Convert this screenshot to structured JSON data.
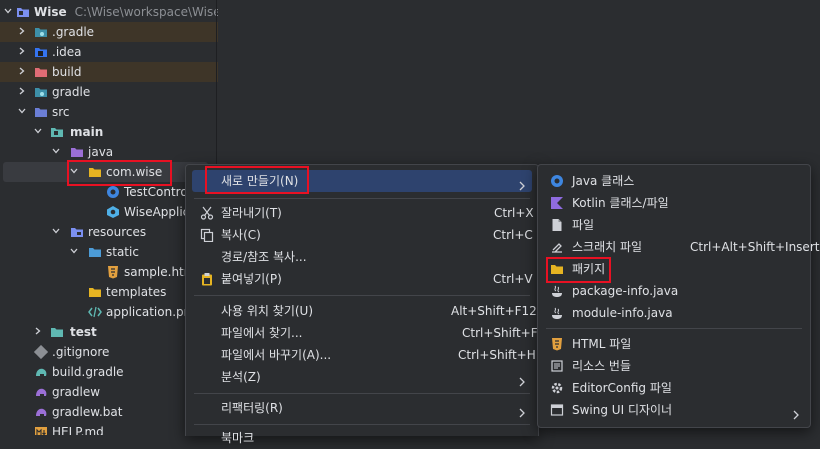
{
  "tree": {
    "root": {
      "name": "Wise",
      "path": "C:\\Wise\\workspace\\Wise"
    },
    "items": [
      {
        "label": ".gradle"
      },
      {
        "label": ".idea"
      },
      {
        "label": "build"
      },
      {
        "label": "gradle"
      },
      {
        "label": "src"
      },
      {
        "label": "main"
      },
      {
        "label": "java"
      },
      {
        "label": "com.wise"
      },
      {
        "label": "TestControl"
      },
      {
        "label": "WiseApplica"
      },
      {
        "label": "resources"
      },
      {
        "label": "static"
      },
      {
        "label": "sample.htm"
      },
      {
        "label": "templates"
      },
      {
        "label": "application.pro"
      },
      {
        "label": "test"
      },
      {
        "label": ".gitignore"
      },
      {
        "label": "build.gradle"
      },
      {
        "label": "gradlew"
      },
      {
        "label": "gradlew.bat"
      },
      {
        "label": "HELP.md"
      }
    ]
  },
  "context_menu": {
    "items": [
      {
        "label": "새로 만들기(N)",
        "shortcut": ""
      },
      {
        "label": "잘라내기(T)",
        "shortcut": "Ctrl+X"
      },
      {
        "label": "복사(C)",
        "shortcut": "Ctrl+C"
      },
      {
        "label": "경로/참조 복사...",
        "shortcut": ""
      },
      {
        "label": "붙여넣기(P)",
        "shortcut": "Ctrl+V"
      },
      {
        "label": "사용 위치 찾기(U)",
        "shortcut": "Alt+Shift+F12"
      },
      {
        "label": "파일에서 찾기...",
        "shortcut": "Ctrl+Shift+F"
      },
      {
        "label": "파일에서 바꾸기(A)...",
        "shortcut": "Ctrl+Shift+H"
      },
      {
        "label": "분석(Z)",
        "shortcut": ""
      },
      {
        "label": "리팩터링(R)",
        "shortcut": ""
      },
      {
        "label": "북마크",
        "shortcut": ""
      }
    ]
  },
  "new_submenu": {
    "items": [
      {
        "label": "Java 클래스",
        "shortcut": ""
      },
      {
        "label": "Kotlin 클래스/파일",
        "shortcut": ""
      },
      {
        "label": "파일",
        "shortcut": ""
      },
      {
        "label": "스크래치 파일",
        "shortcut": "Ctrl+Alt+Shift+Insert"
      },
      {
        "label": "패키지",
        "shortcut": ""
      },
      {
        "label": "package-info.java",
        "shortcut": ""
      },
      {
        "label": "module-info.java",
        "shortcut": ""
      },
      {
        "label": "HTML 파일",
        "shortcut": ""
      },
      {
        "label": "리소스 번들",
        "shortcut": ""
      },
      {
        "label": "EditorConfig 파일",
        "shortcut": ""
      },
      {
        "label": "Swing UI 디자이너",
        "shortcut": ""
      }
    ]
  },
  "colors": {
    "background": "#2b2d30",
    "selection": "#2e436e",
    "highlight_box": "#e81123",
    "folder": "#e6b422",
    "text": "#dfe1e5"
  }
}
